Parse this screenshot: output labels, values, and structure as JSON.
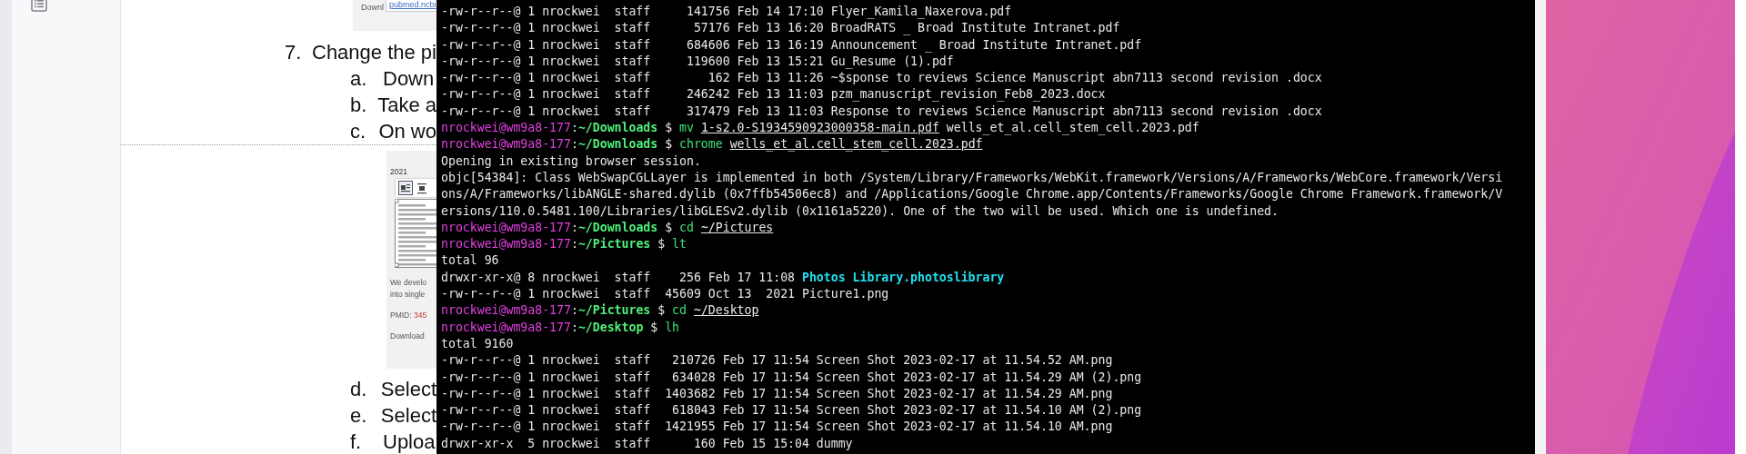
{
  "document": {
    "top_snippet": {
      "text": "Downl",
      "link": "pubmed.ncbi"
    },
    "step": {
      "number": "7.",
      "text": "Change the pi"
    },
    "substeps_before": [
      {
        "label": "a.",
        "text": "Down"
      },
      {
        "label": "b.",
        "text": "Take a"
      },
      {
        "label": "c.",
        "text": "On wo"
      }
    ],
    "figure": {
      "year": "2021",
      "lines": [
        "We develo",
        "into single"
      ],
      "pmid_label": "PMID:",
      "pmid_value": "345",
      "download": "Download"
    },
    "substeps_after": [
      {
        "label": "d.",
        "text": "Select"
      },
      {
        "label": "e.",
        "text": "Select"
      },
      {
        "label": "f.",
        "text": "Uploa"
      }
    ]
  },
  "terminal": {
    "lines": [
      {
        "kind": "entry",
        "info": "-rw-r--r--@ 1 nrockwei  staff     141756 Feb 14 17:10",
        "name": "Flyer_Kamila_Naxerova.pdf",
        "highlighted": false
      },
      {
        "kind": "entry",
        "info": "-rw-r--r--@ 1 nrockwei  staff      57176 Feb 13 16:20",
        "name": "BroadRATS _ Broad Institute Intranet.pdf",
        "highlighted": false
      },
      {
        "kind": "entry",
        "info": "-rw-r--r--@ 1 nrockwei  staff     684606 Feb 13 16:19",
        "name": "Announcement _ Broad Institute Intranet.pdf",
        "highlighted": false
      },
      {
        "kind": "entry",
        "info": "-rw-r--r--@ 1 nrockwei  staff     119600 Feb 13 15:21",
        "name": "Gu_Resume (1).pdf",
        "highlighted": false
      },
      {
        "kind": "entry",
        "info": "-rw-r--r--@ 1 nrockwei  staff        162 Feb 13 11:26",
        "name": "~$sponse to reviews Science Manuscript abn7113 second revision .docx",
        "highlighted": false
      },
      {
        "kind": "entry",
        "info": "-rw-r--r--@ 1 nrockwei  staff     246242 Feb 13 11:03",
        "name": "pzm_manuscript_revision_Feb8_2023.docx",
        "highlighted": false
      },
      {
        "kind": "entry",
        "info": "-rw-r--r--@ 1 nrockwei  staff     317479 Feb 13 11:03",
        "name": "Response to reviews Science Manuscript abn7113 second revision .docx",
        "highlighted": false
      },
      {
        "kind": "prompt",
        "user": "nrockwei@wm9a8-177",
        "separator": ":",
        "path": "~/Downloads",
        "symbol": "$",
        "command": "mv",
        "args": [
          {
            "text": "1-s2.0-S1934590923000358-main.pdf",
            "underlined": true
          },
          {
            "text": "wells_et_al.cell_stem_cell.2023.pdf",
            "underlined": false
          }
        ]
      },
      {
        "kind": "prompt",
        "user": "nrockwei@wm9a8-177",
        "separator": ":",
        "path": "~/Downloads",
        "symbol": "$",
        "command": "chrome",
        "args": [
          {
            "text": "wells_et_al.cell_stem_cell.2023.pdf",
            "underlined": true
          }
        ]
      },
      {
        "kind": "output",
        "text": "Opening in existing browser session."
      },
      {
        "kind": "output",
        "text": "objc[54384]: Class WebSwapCGLLayer is implemented in both /System/Library/Frameworks/WebKit.framework/Versions/A/Frameworks/WebCore.framework/Versi"
      },
      {
        "kind": "output",
        "text": "ons/A/Frameworks/libANGLE-shared.dylib (0x7ffb54506ec8) and /Applications/Google Chrome.app/Contents/Frameworks/Google Chrome Framework.framework/V"
      },
      {
        "kind": "output",
        "text": "ersions/110.0.5481.100/Libraries/libGLESv2.dylib (0x1161a5220). One of the two will be used. Which one is undefined."
      },
      {
        "kind": "prompt",
        "user": "nrockwei@wm9a8-177",
        "separator": ":",
        "path": "~/Downloads",
        "symbol": "$",
        "command": "cd",
        "args": [
          {
            "text": "~/Pictures",
            "underlined": true
          }
        ]
      },
      {
        "kind": "prompt",
        "user": "nrockwei@wm9a8-177",
        "separator": ":",
        "path": "~/Pictures",
        "symbol": "$",
        "command": "lt"
      },
      {
        "kind": "output",
        "text": "total 96"
      },
      {
        "kind": "entry",
        "info": "drwxr-xr-x@ 8 nrockwei  staff    256 Feb 17 11:08",
        "name": "Photos Library.photoslibrary",
        "highlighted": true
      },
      {
        "kind": "entry",
        "info": "-rw-r--r--@ 1 nrockwei  staff  45609 Oct 13  2021",
        "name": "Picture1.png",
        "highlighted": false
      },
      {
        "kind": "prompt",
        "user": "nrockwei@wm9a8-177",
        "separator": ":",
        "path": "~/Pictures",
        "symbol": "$",
        "command": "cd",
        "args": [
          {
            "text": "~/Desktop",
            "underlined": true
          }
        ]
      },
      {
        "kind": "prompt",
        "user": "nrockwei@wm9a8-177",
        "separator": ":",
        "path": "~/Desktop",
        "symbol": "$",
        "command": "lh"
      },
      {
        "kind": "output",
        "text": "total 9160"
      },
      {
        "kind": "entry",
        "info": "-rw-r--r--@ 1 nrockwei  staff   210726 Feb 17 11:54",
        "name": "Screen Shot 2023-02-17 at 11.54.52 AM.png",
        "highlighted": false
      },
      {
        "kind": "entry",
        "info": "-rw-r--r--@ 1 nrockwei  staff   634028 Feb 17 11:54",
        "name": "Screen Shot 2023-02-17 at 11.54.29 AM (2).png",
        "highlighted": false
      },
      {
        "kind": "entry",
        "info": "-rw-r--r--@ 1 nrockwei  staff  1403682 Feb 17 11:54",
        "name": "Screen Shot 2023-02-17 at 11.54.29 AM.png",
        "highlighted": false
      },
      {
        "kind": "entry",
        "info": "-rw-r--r--@ 1 nrockwei  staff   618043 Feb 17 11:54",
        "name": "Screen Shot 2023-02-17 at 11.54.10 AM (2).png",
        "highlighted": false
      },
      {
        "kind": "entry",
        "info": "-rw-r--r--@ 1 nrockwei  staff  1421955 Feb 17 11:54",
        "name": "Screen Shot 2023-02-17 at 11.54.10 AM.png",
        "highlighted": false
      },
      {
        "kind": "entry",
        "info": "drwxr-xr-x  5 nrockwei  staff      160 Feb 15 15:04",
        "name": "dummy",
        "highlighted": false
      }
    ]
  }
}
